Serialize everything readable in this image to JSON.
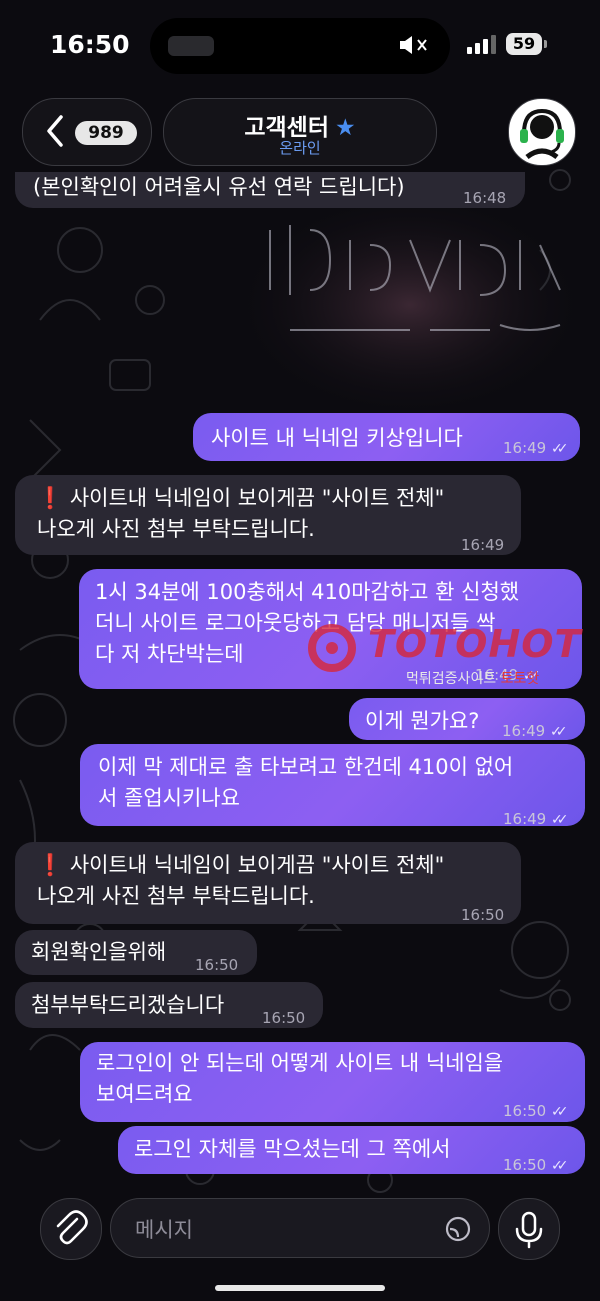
{
  "status_bar": {
    "time": "16:50",
    "battery": "59"
  },
  "header": {
    "back_count": "989",
    "title": "고객센터",
    "star": "★",
    "subtitle": "온라인"
  },
  "messages": [
    {
      "dir": "in",
      "lines": [
        "(본인확인이 어려울시 유선 연락 드립니다)"
      ],
      "time": "16:48"
    },
    {
      "dir": "out",
      "lines": [
        "사이트 내 닉네임 키상입니다"
      ],
      "time": "16:49",
      "read": true
    },
    {
      "dir": "in",
      "lines": [
        "❗ 사이트내 닉네임이 보이게끔 \"사이트 전체\"",
        "   나오게  사진 첨부 부탁드립니다."
      ],
      "time": "16:49"
    },
    {
      "dir": "out",
      "lines": [
        "1시 34분에 100충해서 410마감하고 환 신청했",
        "더니 사이트 로그아웃당하고 담당 매니저들 싹",
        "다 저 차단박는데"
      ],
      "time": "16:49",
      "read": true
    },
    {
      "dir": "out",
      "lines": [
        "이게 뭔가요?"
      ],
      "time": "16:49",
      "read": true
    },
    {
      "dir": "out",
      "lines": [
        "이제 막 제대로 출 타보려고 한건데 410이 없어",
        "서 졸업시키나요"
      ],
      "time": "16:49",
      "read": true
    },
    {
      "dir": "in",
      "lines": [
        "❗ 사이트내 닉네임이 보이게끔 \"사이트 전체\"",
        "   나오게  사진 첨부 부탁드립니다."
      ],
      "time": "16:50"
    },
    {
      "dir": "in",
      "lines": [
        "회원확인을위해"
      ],
      "time": "16:50"
    },
    {
      "dir": "in",
      "lines": [
        "첨부부탁드리겠습니다"
      ],
      "time": "16:50"
    },
    {
      "dir": "out",
      "lines": [
        "로그인이 안 되는데 어떻게 사이트 내 닉네임을",
        "보여드려요"
      ],
      "time": "16:50",
      "read": true
    },
    {
      "dir": "out",
      "lines": [
        "로그인 자체를 막으셨는데 그 쪽에서"
      ],
      "time": "16:50",
      "read": true
    }
  ],
  "watermark": {
    "logo": "TOTOHOT",
    "caption": "먹튀검증사이트",
    "caption_red": "토토핫"
  },
  "composer": {
    "placeholder": "메시지"
  },
  "icons": [
    "back-chevron-icon",
    "verified-star-icon",
    "headset-icon",
    "mute-bell-icon",
    "bluetooth-icon",
    "signal-icon",
    "paperclip-icon",
    "sticker-icon",
    "microphone-icon",
    "read-check-icon"
  ],
  "colors": {
    "incoming": "#2a2833",
    "outgoing": "#7a5cf0",
    "accent": "#4a8ef0",
    "background": "#0c0b10"
  }
}
